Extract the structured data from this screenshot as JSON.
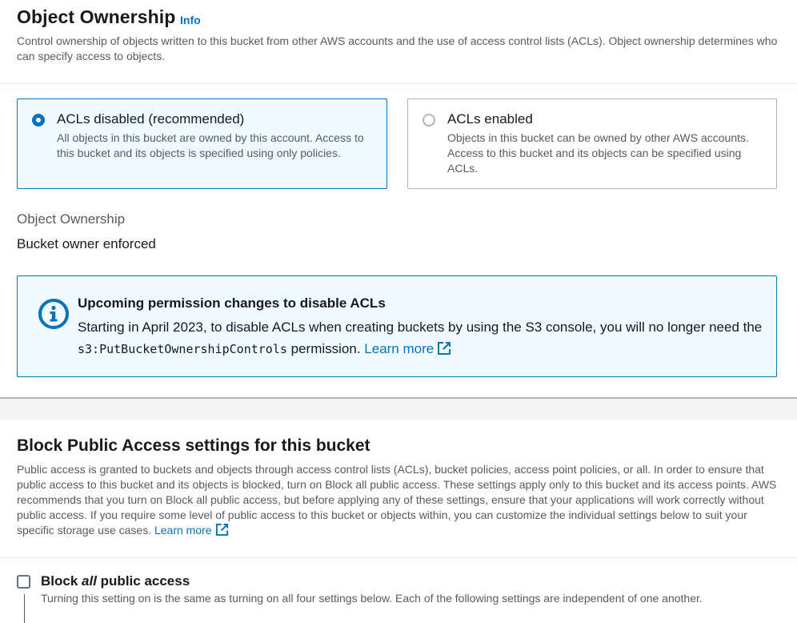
{
  "object_ownership": {
    "title": "Object Ownership",
    "info_link": "Info",
    "description": "Control ownership of objects written to this bucket from other AWS accounts and the use of access control lists (ACLs). Object ownership determines who can specify access to objects.",
    "options": [
      {
        "label": "ACLs disabled (recommended)",
        "description": "All objects in this bucket are owned by this account. Access to this bucket and its objects is specified using only policies.",
        "selected": true
      },
      {
        "label": "ACLs enabled",
        "description": "Objects in this bucket can be owned by other AWS accounts. Access to this bucket and its objects can be specified using ACLs.",
        "selected": false
      }
    ],
    "field_label": "Object Ownership",
    "field_value": "Bucket owner enforced",
    "alert": {
      "title": "Upcoming permission changes to disable ACLs",
      "body_before": "Starting in April 2023, to disable ACLs when creating buckets by using the S3 console, you will no longer need the ",
      "code": "s3:PutBucketOwnershipControls",
      "body_after": " permission. ",
      "link": "Learn more"
    }
  },
  "block_public_access": {
    "title": "Block Public Access settings for this bucket",
    "description": "Public access is granted to buckets and objects through access control lists (ACLs), bucket policies, access point policies, or all. In order to ensure that public access to this bucket and its objects is blocked, turn on Block all public access. These settings apply only to this bucket and its access points. AWS recommends that you turn on Block all public access, but before applying any of these settings, ensure that your applications will work correctly without public access. If you require some level of public access to this bucket or objects within, you can customize the individual settings below to suit your specific storage use cases. ",
    "learn_more": "Learn more",
    "block_all": {
      "label_prefix": "Block ",
      "label_emphasis": "all",
      "label_suffix": " public access",
      "description": "Turning this setting on is the same as turning on all four settings below. Each of the following settings are independent of one another.",
      "checked": false
    }
  },
  "colors": {
    "accent": "#0073bb",
    "selected_bg": "#f1faff",
    "text": "#16191f",
    "secondary_text": "#545b64"
  }
}
